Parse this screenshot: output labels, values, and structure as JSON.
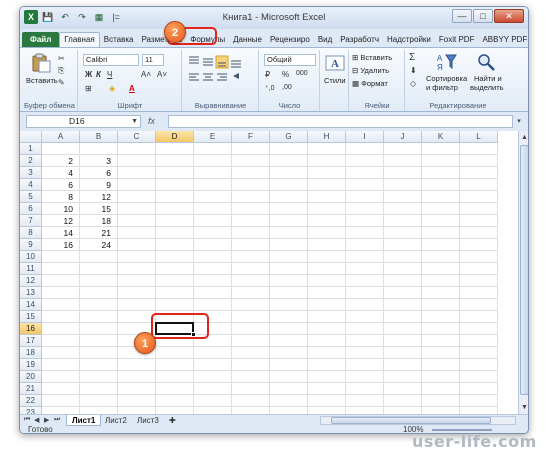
{
  "app": {
    "title": "Книга1  -  Microsoft Excel"
  },
  "window_controls": {
    "minimize": "—",
    "restore": "□",
    "close": "✕"
  },
  "qat": [
    "X",
    "💾",
    "↶",
    "↷",
    "▦",
    "|="
  ],
  "tabs": [
    {
      "label": "Файл",
      "active": false
    },
    {
      "label": "Главная",
      "active": true
    },
    {
      "label": "Вставка",
      "active": false
    },
    {
      "label": "Разметка с",
      "active": false
    },
    {
      "label": "Формулы",
      "active": false
    },
    {
      "label": "Данные",
      "active": false
    },
    {
      "label": "Рецензиро",
      "active": false
    },
    {
      "label": "Вид",
      "active": false
    },
    {
      "label": "Разработч",
      "active": false
    },
    {
      "label": "Надстройки",
      "active": false
    },
    {
      "label": "Foxit PDF",
      "active": false
    },
    {
      "label": "ABBYY PDF",
      "active": false
    }
  ],
  "ribbon": {
    "clipboard": {
      "paste_label": "Вставить",
      "group_label": "Буфер обмена"
    },
    "font": {
      "font_name": "Calibri",
      "font_size": "11",
      "bold": "Ж",
      "italic": "К",
      "underline": "Ч",
      "grow": "A˄",
      "shrink": "A˅",
      "group_label": "Шрифт"
    },
    "alignment": {
      "group_label": "Выравнивание"
    },
    "number": {
      "format": "Общий",
      "percent": "%",
      "thousands": "000",
      "group_label": "Число"
    },
    "styles": {
      "label": "Стили"
    },
    "cells": {
      "insert": "Вставить",
      "delete": "Удалить",
      "format": "Формат",
      "group_label": "Ячейки"
    },
    "editing": {
      "sigma": "Σ",
      "sort_label_1": "Сортировка",
      "sort_label_2": "и фильтр",
      "find_label_1": "Найти и",
      "find_label_2": "выделить",
      "group_label": "Редактирование"
    }
  },
  "formula_bar": {
    "name_box": "D16",
    "fx": "fx",
    "formula": ""
  },
  "grid": {
    "columns": [
      "A",
      "B",
      "C",
      "D",
      "E",
      "F",
      "G",
      "H",
      "I",
      "J",
      "K",
      "L"
    ],
    "selected_column": "D",
    "selected_row": "16",
    "rows": [
      {
        "n": "1",
        "A": "",
        "B": ""
      },
      {
        "n": "2",
        "A": "2",
        "B": "3"
      },
      {
        "n": "3",
        "A": "4",
        "B": "6"
      },
      {
        "n": "4",
        "A": "6",
        "B": "9"
      },
      {
        "n": "5",
        "A": "8",
        "B": "12"
      },
      {
        "n": "6",
        "A": "10",
        "B": "15"
      },
      {
        "n": "7",
        "A": "12",
        "B": "18"
      },
      {
        "n": "8",
        "A": "14",
        "B": "21"
      },
      {
        "n": "9",
        "A": "16",
        "B": "24"
      },
      {
        "n": "10",
        "A": "",
        "B": ""
      },
      {
        "n": "11",
        "A": "",
        "B": ""
      },
      {
        "n": "12",
        "A": "",
        "B": ""
      },
      {
        "n": "13",
        "A": "",
        "B": ""
      },
      {
        "n": "14",
        "A": "",
        "B": ""
      },
      {
        "n": "15",
        "A": "",
        "B": ""
      },
      {
        "n": "16",
        "A": "",
        "B": ""
      },
      {
        "n": "17",
        "A": "",
        "B": ""
      },
      {
        "n": "18",
        "A": "",
        "B": ""
      },
      {
        "n": "19",
        "A": "",
        "B": ""
      },
      {
        "n": "20",
        "A": "",
        "B": ""
      },
      {
        "n": "21",
        "A": "",
        "B": ""
      },
      {
        "n": "22",
        "A": "",
        "B": ""
      },
      {
        "n": "23",
        "A": "",
        "B": ""
      }
    ]
  },
  "sheets": [
    {
      "label": "Лист1",
      "active": true
    },
    {
      "label": "Лист2",
      "active": false
    },
    {
      "label": "Лист3",
      "active": false
    }
  ],
  "status": {
    "ready": "Готово",
    "zoom": "100%"
  },
  "annotations": {
    "badge1": "1",
    "badge2": "2",
    "accent": "#e1251b"
  },
  "watermark": "user-life.com"
}
